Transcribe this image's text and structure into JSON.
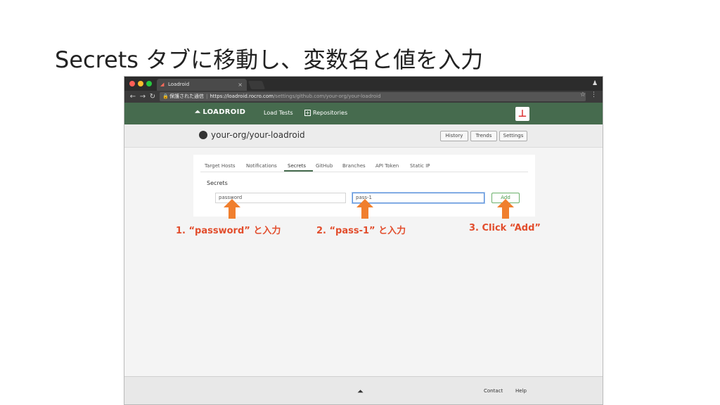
{
  "slide": {
    "title": "Secrets タブに移動し、変数名と値を入力",
    "annotations": [
      "1. “password” と入力",
      "2. “pass-1” と入力",
      "3. Click “Add”"
    ],
    "arrow_color": "#f07f2e",
    "annotation_color": "#e24d2c"
  },
  "browser": {
    "tab_title": "Loadroid",
    "tab_close": "×",
    "secure_label": "保護された通信",
    "url_main": "https://loadroid.rocro.com",
    "url_path": "/settings/github.com/your-org/your-loadroid"
  },
  "app": {
    "brand_color": "#466b4e",
    "logo_text": "LOADROID",
    "nav": [
      "Load Tests",
      "Repositories"
    ],
    "repo_name": "your-org/your-loadroid",
    "repo_buttons": [
      "History",
      "Trends",
      "Settings"
    ]
  },
  "settings": {
    "tabs": [
      "Target Hosts",
      "Notifications",
      "Secrets",
      "GitHub",
      "Branches",
      "API Token",
      "Static IP"
    ],
    "active_tab": "Secrets",
    "section_title": "Secrets",
    "key_value": "password",
    "value_value": "pass-1",
    "add_label": "Add"
  },
  "footer": {
    "links": [
      "Contact",
      "Help"
    ]
  }
}
